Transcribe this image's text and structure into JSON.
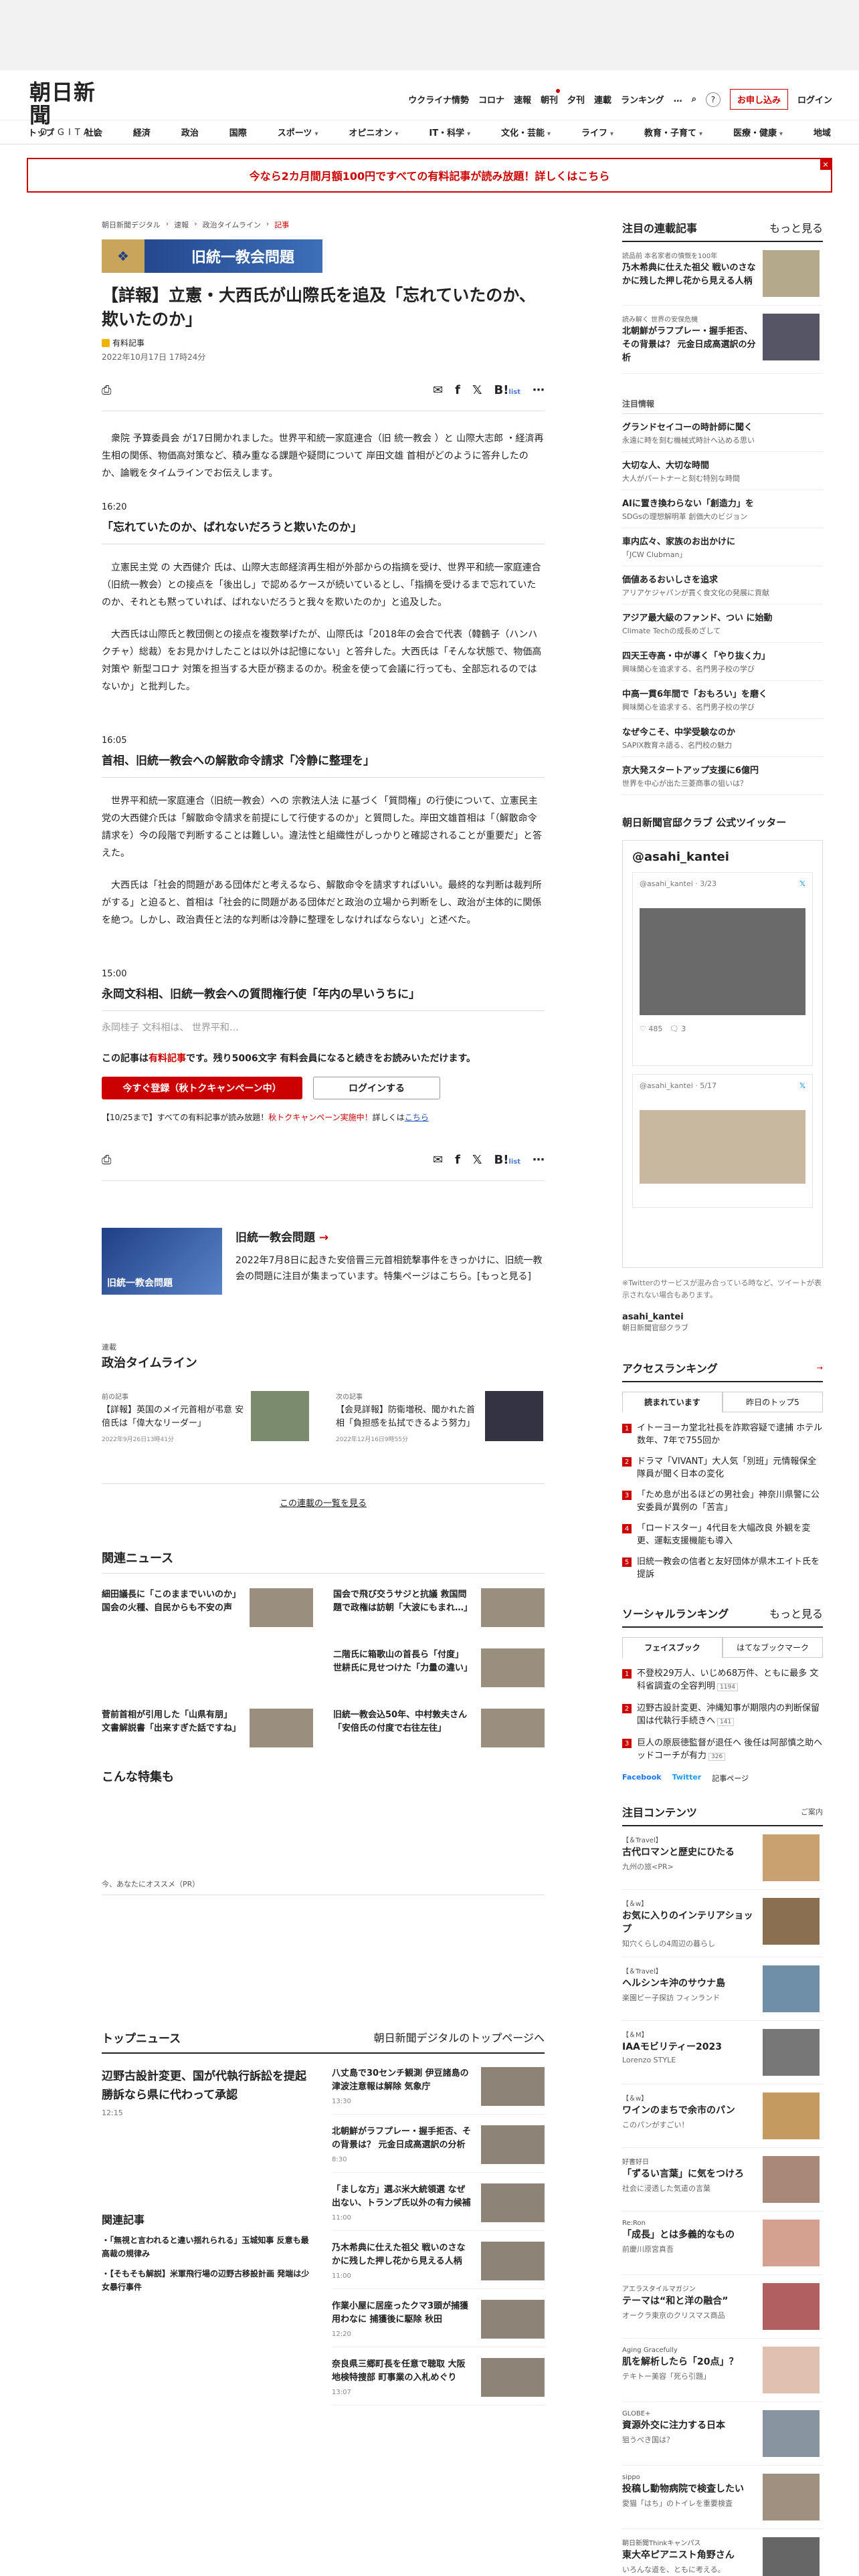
{
  "header": {
    "logo": "朝日新聞",
    "logo_sub": "DIGITAL",
    "util": [
      "ウクライナ情勢",
      "コロナ",
      "速報",
      "朝刊",
      "夕刊",
      "連載",
      "ランキング",
      "…"
    ],
    "subscribe": "お申し込み",
    "login": "ログイン",
    "help": "?"
  },
  "gnav": [
    "トップ",
    "社会",
    "経済",
    "政治",
    "国際",
    "スポーツ",
    "オピニオン",
    "IT・科学",
    "文化・芸能",
    "ライフ",
    "教育・子育て",
    "医療・健康",
    "地域"
  ],
  "promo": "今なら2カ月間月額100円ですべての有料記事が読み放題！詳しくはこちら",
  "crumb": [
    "朝日新聞デジタル",
    "速報",
    "政治タイムライン",
    "記事"
  ],
  "banner": "旧統一教会問題",
  "article": {
    "title": "【詳報】立憲・大西氏が山際氏を追及「忘れていたのか、欺いたのか」",
    "tag": "有料記事",
    "date": "2022年10月17日 17時24分",
    "lead": "衆院 予算委員会 が17日開かれました。世界平和統一家庭連合（旧 統一教会 ）と 山際大志郎 ・経済再生相の関係、物価高対策など、積み重なる課題や疑問について 岸田文雄 首相がどのように答弁したのか、論戦をタイムラインでお伝えします。",
    "t1": "16:20",
    "h1": "「忘れていたのか、ばれないだろうと欺いたのか」",
    "p1": "立憲民主党 の 大西健介 氏は、山際大志郎経済再生相が外部からの指摘を受け、世界平和統一家庭連合（旧統一教会）との接点を「後出し」で認めるケースが続いているとし、「指摘を受けるまで忘れていたのか、それとも黙っていれば、ばれないだろうと我々を欺いたのか」と追及した。",
    "p2": "大西氏は山際氏と教団側との接点を複数挙げたが、山際氏は「2018年の会合で代表（韓鶴子（ハンハクチャ）総裁）をお見かけしたことは以外は記憶にない」と答弁した。大西氏は「そんな状態で、物価高対策や 新型コロナ 対策を担当する大臣が務まるのか。税金を使って会議に行っても、全部忘れるのではないか」と批判した。",
    "t2": "16:05",
    "h2": "首相、旧統一教会への解散命令請求「冷静に整理を」",
    "p3": "世界平和統一家庭連合（旧統一教会）への 宗教法人法 に基づく「質問権」の行使について、立憲民主党の大西健介氏は「解散命令請求を前提にして行使するのか」と質問した。岸田文雄首相は「（解散命令請求を）今の段階で判断することは難しい。違法性と組織性がしっかりと確認されることが重要だ」と答えた。",
    "p4": "大西氏は「社会的問題がある団体だと考えるなら、解散命令を請求すればいい。最終的な判断は裁判所がする」と迫ると、首相は「社会的に問題がある団体だと政治の立場から判断をし、政治が主体的に関係を絶つ。しかし、政治責任と法的な判断は冷静に整理をしなければならない」と述べた。",
    "t3": "15:00",
    "h3": "永岡文科相、旧統一教会への質問権行使「年内の早いうちに」",
    "fade": "永岡桂子 文科相は、 世界平和…"
  },
  "paywall": {
    "a": "この記事は",
    "b": "有料記事",
    "c": "です。残り5006文字",
    "d": "有料会員になると続きをお読みいただけます。",
    "reg": "今すぐ登録（秋トクキャンペーン中）",
    "login": "ログインする",
    "note1": "【10/25まで】すべての有料記事が読み放題！",
    "note2": "秋トクキャンペーン実施中！",
    "note3": "詳しくは",
    "note4": "こちら"
  },
  "share_note": "list",
  "feature": {
    "thumb": "旧統一教会問題",
    "h": "旧統一教会問題",
    "d": "2022年7月8日に起きた安倍晋三元首相銃撃事件をきっかけに、旧統一教会の問題に注目が集まっています。特集ページはこちら。[もっと見る]"
  },
  "series": {
    "lbl": "連載",
    "nm": "政治タイムライン",
    "items": [
      {
        "k": "前の記事",
        "t": "【詳報】英国のメイ元首相が弔意 安倍氏は「偉大なリーダー」",
        "d": "2022年9月26日13時41分"
      },
      {
        "k": "次の記事",
        "t": "【会見詳報】防衛増税、聞かれた首相「負担感を払拭できるよう努力」",
        "d": "2022年12月16日9時55分"
      }
    ],
    "more": "この連載の一覧を見る"
  },
  "related": {
    "h": "関連ニュース",
    "items": [
      "細田議長に「このままでいいのか」 国会の火種、自民からも不安の声",
      "国会で飛び交うサジと抗議 救国問題で政権は訪朝「大波にもまれ…」",
      "",
      "二階氏に箱歌山の首長ら「付度」 世耕氏に見せつけた「力量の違い」",
      "菅前首相が引用した「山県有朋」 文書解説書「出来すぎた話ですね」",
      "旧統一教会込50年、中村敦夫さん「安倍氏の付度で右往左往」"
    ]
  },
  "special": "こんな特集も",
  "rec": "今、あなたにオススメ（PR）",
  "topnews": {
    "h": "トップニュース",
    "link": "朝日新聞デジタルのトップページへ",
    "lead": "辺野古設計変更、国が代執行訴訟を提起 勝訴なら県に代わって承認",
    "lt": "12:15",
    "items": [
      {
        "t": "八丈島で30センチ観測 伊豆諸島の津波注意報は解除 気象庁",
        "tm": "13:30"
      },
      {
        "t": "北朝鮮がラフプレー・握手拒否、その背景は？ 元金日成高選訳の分析",
        "tm": "8:30"
      },
      {
        "t": "「ましな方」選ぶ米大統領選 なぜ出ない、トランプ氏以外の有力候補",
        "tm": "11:00"
      },
      {
        "t": "乃木希典に仕えた祖父 戦いのさなかに残した押し花から見える人柄",
        "tm": "11:00"
      },
      {
        "t": "作業小屋に居座ったクマ3頭が捕獲用わなに 捕獲後に駆除 秋田",
        "tm": "12:20"
      },
      {
        "t": "奈良県三郷町長を任意で聴取 大阪地検特捜部 町事業の入札めぐり",
        "tm": "13:07"
      }
    ]
  },
  "relart": {
    "h": "関連記事",
    "items": [
      "「無視と言われると違い揺れられる」玉城知事 反意も最高裁の規律み",
      "【そもそも解説】米軍飛行場の辺野古移設計画 発端は少女暴行事件"
    ]
  },
  "side": {
    "series_h": "注目の連載記事",
    "more": "もっと見る",
    "series": [
      {
        "k": "読品前 本名家者の憤慨を100年",
        "t": "乃木希典に仕えた祖父 戦いのさなかに残した押し花から見える人柄"
      },
      {
        "k": "読み解く 世界の安保危機",
        "t": "北朝鮮がラフプレー・握手拒否、その背景は？ 元金日成高選訳の分析"
      }
    ],
    "hl_h": "注目情報",
    "hl": [
      {
        "t": "グランドセイコーの時計師に聞く",
        "s": "永遠に時を刻む機械式時計へ込める思い"
      },
      {
        "t": "大切な人、大切な時間",
        "s": "大人がパートナーと刻む特別な時間"
      },
      {
        "t": "AIに置き換わらない「創造力」を",
        "s": "SDGsの理想解明革 創価大のビジョン"
      },
      {
        "t": "車内広々、家族のお出かけに",
        "s": "「JCW Clubman」"
      },
      {
        "t": "価値あるおいしさを追求",
        "s": "アリアケジャパンが貫く食文化の発展に貢献"
      },
      {
        "t": "アジア最大級のファンド、つい に始動",
        "s": "Climate Techの成長めざして"
      },
      {
        "t": "四天王寺高・中が導く「やり抜く力」",
        "s": "興味関心を追求する、名門男子校の学び"
      },
      {
        "t": "中高一貫6年間で「おもろい」を磨く",
        "s": "興味関心を追求する、名門男子校の学び"
      },
      {
        "t": "なぜ今こそ、中学受験なのか",
        "s": "SAPIX教育ネ語る、名門校の魅力"
      },
      {
        "t": "京大発スタートアップ支援に6億円",
        "s": "世界を中心が出た三菱商事の狙いは？"
      }
    ],
    "tw_h": "朝日新聞官邸クラブ 公式ツイッター",
    "tw_acct": "@asahi_kantei",
    "tw_name": "@asahi_kantei · 3/23",
    "tw_name2": "@asahi_kantei · 5/17",
    "tw_likes": "485",
    "tw_rep": "3",
    "tw_foot": "※Twitterのサービスが混み合っている時など、ツイートが表示されない場合もあります。",
    "kantei": "asahi_kantei",
    "kantei2": "朝日新聞官邸クラブ",
    "rank_h": "アクセスランキング",
    "tab1": "読まれています",
    "tab2": "昨日のトップ5",
    "rank": [
      "イトーヨーカ堂北社長を詐欺容疑で逮捕 ホテル数年、7年で755回か",
      "ドラマ「VIVANT」大人気「別班」元情報保全隊員が聞く日本の変化",
      "「ため息が出るほどの男社会」神奈川県警に公安委員が異例の「苦言」",
      "「ロードスター」4代目を大幅改良 外観を変更、運転支援機能も導入",
      "旧統一教会の信者と友好団体が県木エイト氏を提訴"
    ],
    "soc_h": "ソーシャルランキング",
    "soc_tab1": "フェイスブック",
    "soc_tab2": "はてなブックマーク",
    "soc": [
      {
        "t": "不登校29万人、いじめ68万件、ともに最多 文科省調査の全容判明",
        "b": "1194"
      },
      {
        "t": "辺野古設計変更、沖縄知事が期限内の判断保留 国は代執行手続きへ",
        "b": "141"
      },
      {
        "t": "巨人の原辰徳監督が退任へ 後任は阿部慎之助ヘッドコーチが有力",
        "b": "326"
      }
    ],
    "soc_fb": "Facebook",
    "soc_tw": "Twitter",
    "soc_more": "記事ページ",
    "ct_h": "注目コンテンツ",
    "ct_more": "ご案内",
    "ct": [
      {
        "k": "【＆Travel】",
        "t": "古代ロマンと歴史にひたる",
        "s": "九州の旅<PR>"
      },
      {
        "k": "【＆w】",
        "t": "お気に入りのインテリアショップ",
        "s": "知穴くらしの4周辺の暮らし"
      },
      {
        "k": "【＆Travel】",
        "t": "ヘルシンキ沖のサウナ島",
        "s": "楽園ピー子探訪 フィンランド"
      },
      {
        "k": "【＆M】",
        "t": "IAAモビリティー2023",
        "s": "Lorenzo STYLE"
      },
      {
        "k": "【＆w】",
        "t": "ワインのまちで余市のパン",
        "s": "このパンがすごい！"
      },
      {
        "k": "好書好日",
        "t": "「ずるい言葉」に気をつけろ",
        "s": "社会に浸透した気遣の言葉"
      },
      {
        "k": "Re:Ron",
        "t": "「成長」とは多義的なもの",
        "s": "前慶川原宮真吾"
      },
      {
        "k": "アエラスタイルマガジン",
        "t": "テーマは“和と洋の融合”",
        "s": "オークラ東京のクリスマス商品"
      },
      {
        "k": "Aging Gracefully",
        "t": "肌を解析したら「20点」？",
        "s": "テキトー美容「死ら引題」"
      },
      {
        "k": "GLOBE+",
        "t": "資源外交に注力する日本",
        "s": "狙うべき国は？"
      },
      {
        "k": "sippo",
        "t": "投稿し動物病院で検査したい",
        "s": "愛猫「はち」のトイレを重要検査"
      },
      {
        "k": "朝日新聞Thinkキャンパス",
        "t": "東大卒ピアニスト角野さん",
        "s": "いろんな道を、ともに考える。"
      }
    ]
  }
}
